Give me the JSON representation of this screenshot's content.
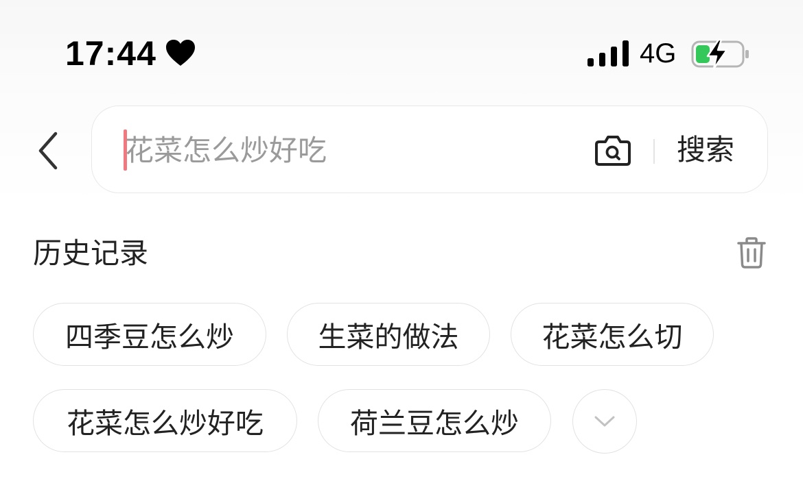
{
  "status_bar": {
    "time": "17:44",
    "heart_icon": "heart-icon",
    "signal_icon": "cellular-signal-icon",
    "network": "4G",
    "battery_icon": "battery-charging-icon",
    "battery_color": "#34c759"
  },
  "search": {
    "back_icon": "chevron-left-icon",
    "placeholder": "花菜怎么炒好吃",
    "value": "",
    "camera_icon": "camera-search-icon",
    "submit_label": "搜索",
    "cursor_color": "#f0787e"
  },
  "history": {
    "title": "历史记录",
    "clear_icon": "trash-icon",
    "items": [
      "四季豆怎么炒",
      "生菜的做法",
      "花菜怎么切",
      "花菜怎么炒好吃",
      "荷兰豆怎么炒"
    ],
    "expand_icon": "chevron-down-icon"
  }
}
